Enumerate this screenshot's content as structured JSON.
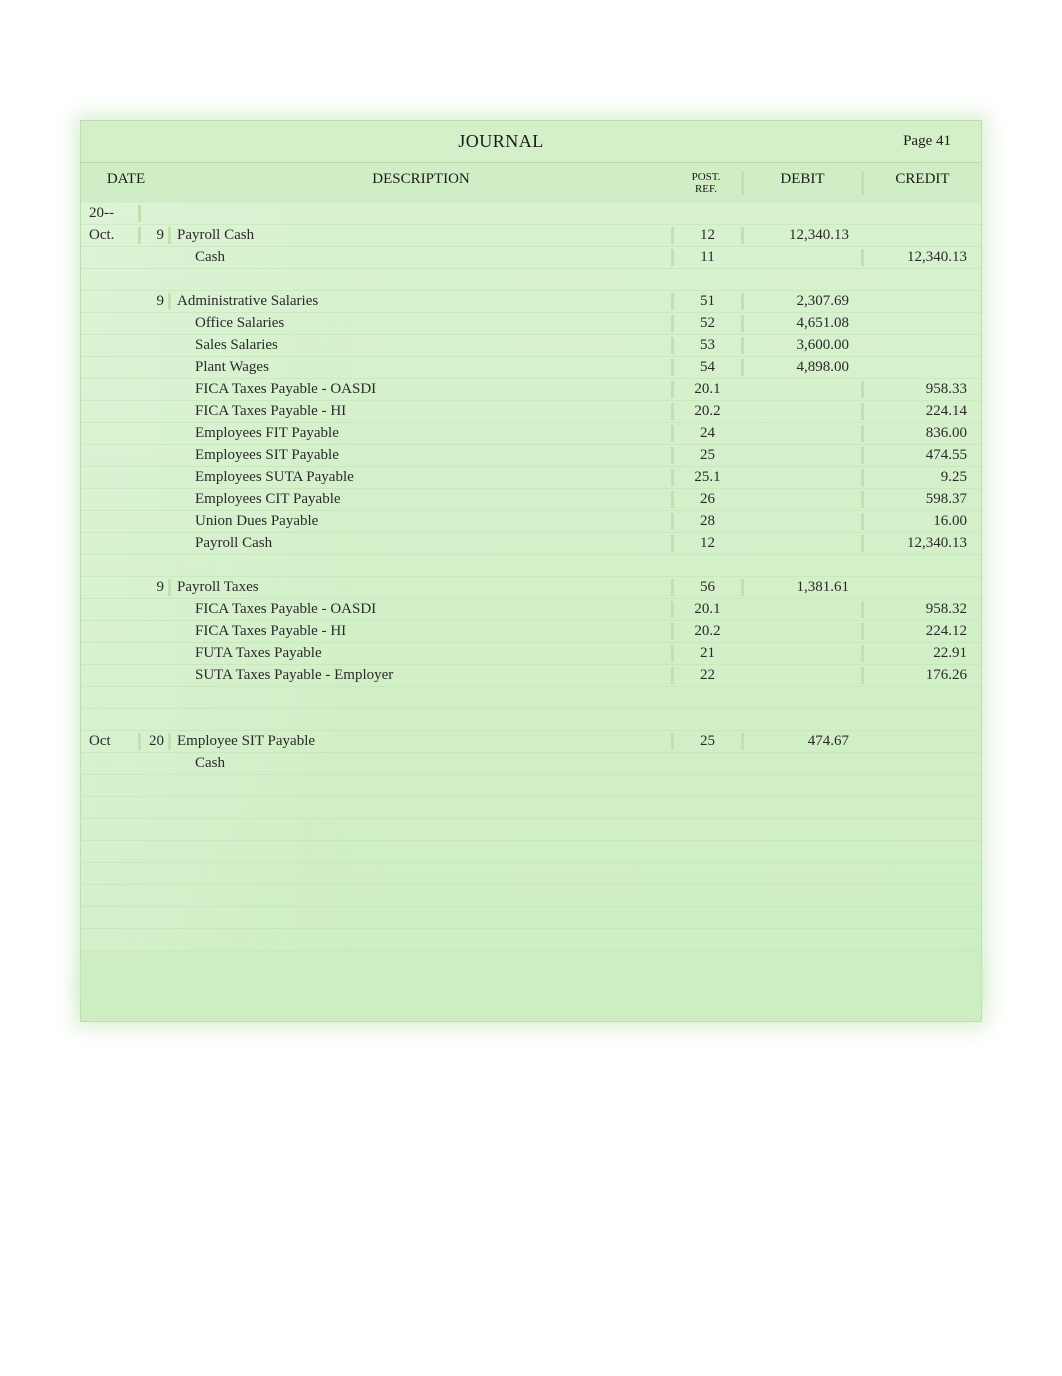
{
  "journal": {
    "title": "JOURNAL",
    "page_label": "Page",
    "page_number": "41"
  },
  "headers": {
    "date": "DATE",
    "description": "DESCRIPTION",
    "post_ref1": "POST.",
    "post_ref2": "REF.",
    "debit": "DEBIT",
    "credit": "CREDIT"
  },
  "rows": [
    {
      "date": "20--",
      "day": "",
      "desc": "",
      "indent": 0,
      "pr": "",
      "debit": "",
      "credit": ""
    },
    {
      "date": "Oct.",
      "day": "9",
      "desc": "Payroll Cash",
      "indent": 1,
      "pr": "12",
      "debit": "12,340.13",
      "credit": ""
    },
    {
      "date": "",
      "day": "",
      "desc": "Cash",
      "indent": 2,
      "pr": "11",
      "debit": "",
      "credit": "12,340.13"
    },
    {
      "date": "",
      "day": "",
      "desc": "",
      "indent": 0,
      "pr": "",
      "debit": "",
      "credit": ""
    },
    {
      "date": "",
      "day": "9",
      "desc": "Administrative Salaries",
      "indent": 1,
      "pr": "51",
      "debit": "2,307.69",
      "credit": ""
    },
    {
      "date": "",
      "day": "",
      "desc": "Office Salaries",
      "indent": 2,
      "pr": "52",
      "debit": "4,651.08",
      "credit": ""
    },
    {
      "date": "",
      "day": "",
      "desc": "Sales Salaries",
      "indent": 2,
      "pr": "53",
      "debit": "3,600.00",
      "credit": ""
    },
    {
      "date": "",
      "day": "",
      "desc": "Plant Wages",
      "indent": 2,
      "pr": "54",
      "debit": "4,898.00",
      "credit": ""
    },
    {
      "date": "",
      "day": "",
      "desc": "FICA Taxes Payable - OASDI",
      "indent": 3,
      "pr": "20.1",
      "debit": "",
      "credit": "958.33"
    },
    {
      "date": "",
      "day": "",
      "desc": "FICA Taxes Payable - HI",
      "indent": 3,
      "pr": "20.2",
      "debit": "",
      "credit": "224.14"
    },
    {
      "date": "",
      "day": "",
      "desc": "Employees FIT Payable",
      "indent": 3,
      "pr": "24",
      "debit": "",
      "credit": "836.00"
    },
    {
      "date": "",
      "day": "",
      "desc": "Employees SIT Payable",
      "indent": 3,
      "pr": "25",
      "debit": "",
      "credit": "474.55"
    },
    {
      "date": "",
      "day": "",
      "desc": "Employees SUTA Payable",
      "indent": 3,
      "pr": "25.1",
      "debit": "",
      "credit": "9.25"
    },
    {
      "date": "",
      "day": "",
      "desc": "Employees CIT Payable",
      "indent": 3,
      "pr": "26",
      "debit": "",
      "credit": "598.37"
    },
    {
      "date": "",
      "day": "",
      "desc": "Union Dues Payable",
      "indent": 3,
      "pr": "28",
      "debit": "",
      "credit": "16.00"
    },
    {
      "date": "",
      "day": "",
      "desc": "Payroll Cash",
      "indent": 3,
      "pr": "12",
      "debit": "",
      "credit": "12,340.13"
    },
    {
      "date": "",
      "day": "",
      "desc": "",
      "indent": 0,
      "pr": "",
      "debit": "",
      "credit": ""
    },
    {
      "date": "",
      "day": "9",
      "desc": "Payroll Taxes",
      "indent": 1,
      "pr": "56",
      "debit": "1,381.61",
      "credit": ""
    },
    {
      "date": "",
      "day": "",
      "desc": "FICA Taxes Payable - OASDI",
      "indent": 3,
      "pr": "20.1",
      "debit": "",
      "credit": "958.32"
    },
    {
      "date": "",
      "day": "",
      "desc": "FICA Taxes Payable - HI",
      "indent": 3,
      "pr": "20.2",
      "debit": "",
      "credit": "224.12"
    },
    {
      "date": "",
      "day": "",
      "desc": "FUTA Taxes Payable",
      "indent": 3,
      "pr": "21",
      "debit": "",
      "credit": "22.91"
    },
    {
      "date": "",
      "day": "",
      "desc": "SUTA Taxes Payable - Employer",
      "indent": 3,
      "pr": "22",
      "debit": "",
      "credit": "176.26"
    },
    {
      "date": "",
      "day": "",
      "desc": "",
      "indent": 0,
      "pr": "",
      "debit": "",
      "credit": ""
    },
    {
      "date": "",
      "day": "",
      "desc": "",
      "indent": 0,
      "pr": "",
      "debit": "",
      "credit": ""
    },
    {
      "date": "Oct",
      "day": "20",
      "desc": "Employee SIT Payable",
      "indent": 1,
      "pr": "25",
      "debit": "474.67",
      "credit": ""
    },
    {
      "date": "",
      "day": "",
      "desc": "Cash",
      "indent": 2,
      "pr": "",
      "debit": "",
      "credit": ""
    },
    {
      "date": "",
      "day": "",
      "desc": "",
      "indent": 0,
      "pr": "",
      "debit": "",
      "credit": ""
    },
    {
      "date": "",
      "day": "",
      "desc": "",
      "indent": 0,
      "pr": "",
      "debit": "",
      "credit": ""
    },
    {
      "date": "",
      "day": "",
      "desc": "",
      "indent": 0,
      "pr": "",
      "debit": "",
      "credit": ""
    },
    {
      "date": "",
      "day": "",
      "desc": "",
      "indent": 0,
      "pr": "",
      "debit": "",
      "credit": ""
    },
    {
      "date": "",
      "day": "",
      "desc": "",
      "indent": 0,
      "pr": "",
      "debit": "",
      "credit": ""
    },
    {
      "date": "",
      "day": "",
      "desc": "",
      "indent": 0,
      "pr": "",
      "debit": "",
      "credit": ""
    },
    {
      "date": "",
      "day": "",
      "desc": "",
      "indent": 0,
      "pr": "",
      "debit": "",
      "credit": ""
    },
    {
      "date": "",
      "day": "",
      "desc": "",
      "indent": 0,
      "pr": "",
      "debit": "",
      "credit": ""
    }
  ]
}
